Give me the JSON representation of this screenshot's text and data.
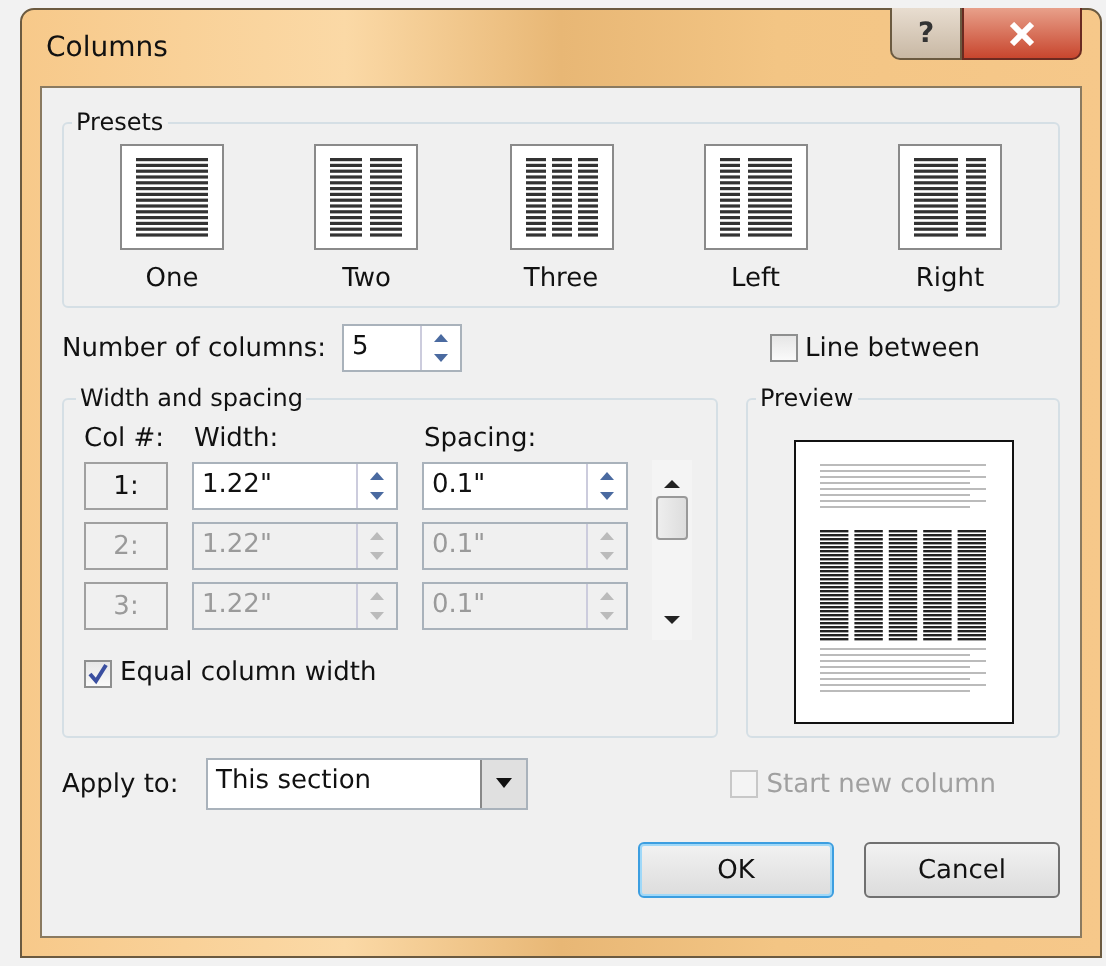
{
  "window": {
    "title": "Columns",
    "help": "?"
  },
  "presets": {
    "title": "Presets",
    "items": [
      {
        "label": "One",
        "kind": "one"
      },
      {
        "label": "Two",
        "kind": "two"
      },
      {
        "label": "Three",
        "kind": "three"
      },
      {
        "label": "Left",
        "kind": "left"
      },
      {
        "label": "Right",
        "kind": "right"
      }
    ]
  },
  "number_of_columns": {
    "label": "Number of columns:",
    "value": "5"
  },
  "line_between": {
    "label": "Line between",
    "checked": false
  },
  "width_and_spacing": {
    "title": "Width and spacing",
    "headers": [
      "Col #:",
      "Width:",
      "Spacing:"
    ],
    "rows": [
      {
        "col": "1:",
        "width": "1.22\"",
        "spacing": "0.1\"",
        "disabled": false
      },
      {
        "col": "2:",
        "width": "1.22\"",
        "spacing": "0.1\"",
        "disabled": true
      },
      {
        "col": "3:",
        "width": "1.22\"",
        "spacing": "0.1\"",
        "disabled": true
      }
    ]
  },
  "equal_column_width": {
    "label": "Equal column width",
    "checked": true
  },
  "preview": {
    "title": "Preview"
  },
  "apply_to": {
    "label": "Apply to:",
    "value": "This section"
  },
  "start_new_column": {
    "label": "Start new column",
    "checked": false,
    "disabled": true
  },
  "buttons": [
    {
      "label": "OK",
      "default": true
    },
    {
      "label": "Cancel",
      "default": false
    }
  ]
}
